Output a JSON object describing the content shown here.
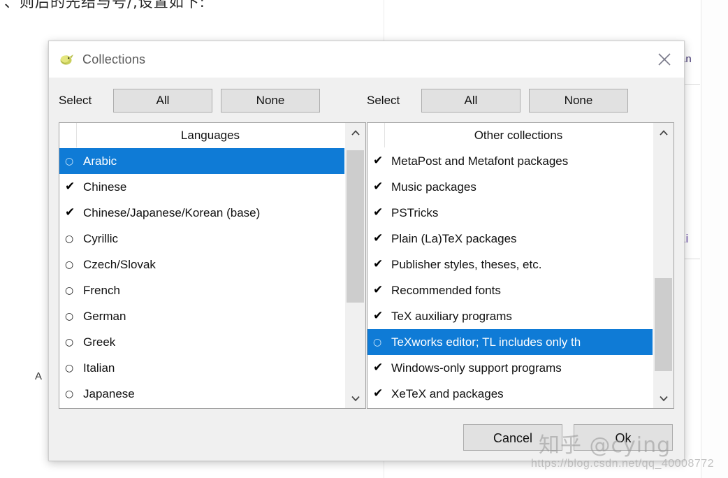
{
  "background": {
    "top_text": "、则后的先结与号/,设置如下:",
    "fragment_right_top": "an",
    "fragment_right_link": "Li",
    "fragment_left": "A"
  },
  "dialog": {
    "title": "Collections",
    "icon": "texlive-kiwi-icon",
    "close_icon": "close-icon",
    "left_panel": {
      "select_label": "Select",
      "all_label": "All",
      "none_label": "None",
      "header": "Languages",
      "items": [
        {
          "label": "Arabic",
          "checked": false,
          "selected": true
        },
        {
          "label": "Chinese",
          "checked": true,
          "selected": false
        },
        {
          "label": "Chinese/Japanese/Korean (base)",
          "checked": true,
          "selected": false
        },
        {
          "label": "Cyrillic",
          "checked": false,
          "selected": false
        },
        {
          "label": "Czech/Slovak",
          "checked": false,
          "selected": false
        },
        {
          "label": "French",
          "checked": false,
          "selected": false
        },
        {
          "label": "German",
          "checked": false,
          "selected": false
        },
        {
          "label": "Greek",
          "checked": false,
          "selected": false
        },
        {
          "label": "Italian",
          "checked": false,
          "selected": false
        },
        {
          "label": "Japanese",
          "checked": false,
          "selected": false
        }
      ],
      "scrollbar": {
        "thumb_top_pct": 3,
        "thumb_height_pct": 62
      }
    },
    "right_panel": {
      "select_label": "Select",
      "all_label": "All",
      "none_label": "None",
      "header": "Other collections",
      "items": [
        {
          "label": "MetaPost and Metafont packages",
          "checked": true,
          "selected": false
        },
        {
          "label": "Music packages",
          "checked": true,
          "selected": false
        },
        {
          "label": "PSTricks",
          "checked": true,
          "selected": false
        },
        {
          "label": "Plain (La)TeX packages",
          "checked": true,
          "selected": false
        },
        {
          "label": "Publisher styles, theses, etc.",
          "checked": true,
          "selected": false
        },
        {
          "label": "Recommended fonts",
          "checked": true,
          "selected": false
        },
        {
          "label": "TeX auxiliary programs",
          "checked": true,
          "selected": false
        },
        {
          "label": "TeXworks editor; TL includes only th",
          "checked": false,
          "selected": true
        },
        {
          "label": "Windows-only support programs",
          "checked": true,
          "selected": false
        },
        {
          "label": "XeTeX and packages",
          "checked": true,
          "selected": false
        }
      ],
      "scrollbar": {
        "thumb_top_pct": 55,
        "thumb_height_pct": 38
      }
    },
    "footer": {
      "cancel_label": "Cancel",
      "ok_label": "Ok"
    }
  },
  "watermark": {
    "text": "知乎 @cying",
    "url": "https://blog.csdn.net/qq_40008772"
  },
  "colors": {
    "selection_blue": "#0f7bd6",
    "dialog_bg": "#f0f0f0",
    "button_face": "#e1e1e1",
    "scroll_thumb": "#cdcdcd"
  }
}
